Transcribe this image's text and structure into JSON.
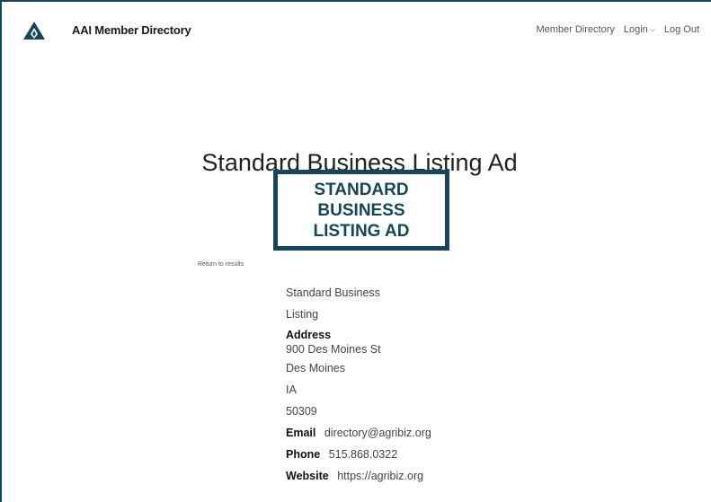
{
  "header": {
    "brand": "AAI Member Directory",
    "logo_icon": "mountain-logo-icon",
    "nav": {
      "member_directory": "Member Directory",
      "login": "Login",
      "logout": "Log Out"
    }
  },
  "page": {
    "title": "Standard Business Listing Ad",
    "ad_lines": [
      "STANDARD",
      "BUSINESS",
      "LISTING AD"
    ],
    "return_link": "Return to results"
  },
  "listing": {
    "name_line1": "Standard Business",
    "name_line2": "Listing",
    "address_label": "Address",
    "street": "900 Des Moines St",
    "city": "Des Moines",
    "state": "IA",
    "zip": "50309",
    "email_label": "Email",
    "email": "directory@agribiz.org",
    "phone_label": "Phone",
    "phone": "515.868.0322",
    "website_label": "Website",
    "website": "https://agribiz.org"
  },
  "colors": {
    "accent": "#17455a"
  }
}
